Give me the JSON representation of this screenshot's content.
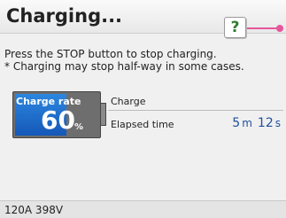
{
  "header": {
    "title": "Charging...",
    "help_label": "?"
  },
  "messages": {
    "line1": "Press the STOP button to stop charging.",
    "line2": "* Charging may stop half-way in some cases."
  },
  "battery": {
    "label": "Charge rate",
    "value": "60",
    "unit": "%",
    "fill_fraction": 0.6
  },
  "charge": {
    "heading": "Charge",
    "elapsed_label": "Elapsed time",
    "minutes": "5",
    "minutes_unit": "m",
    "seconds": "12",
    "seconds_unit": "s"
  },
  "footer": {
    "status": "120A  398V"
  },
  "colors": {
    "accent": "#e6569a",
    "battery_blue": "#1f6fd1",
    "time_blue": "#1f4f9e",
    "help_green": "#2d7d2d"
  }
}
